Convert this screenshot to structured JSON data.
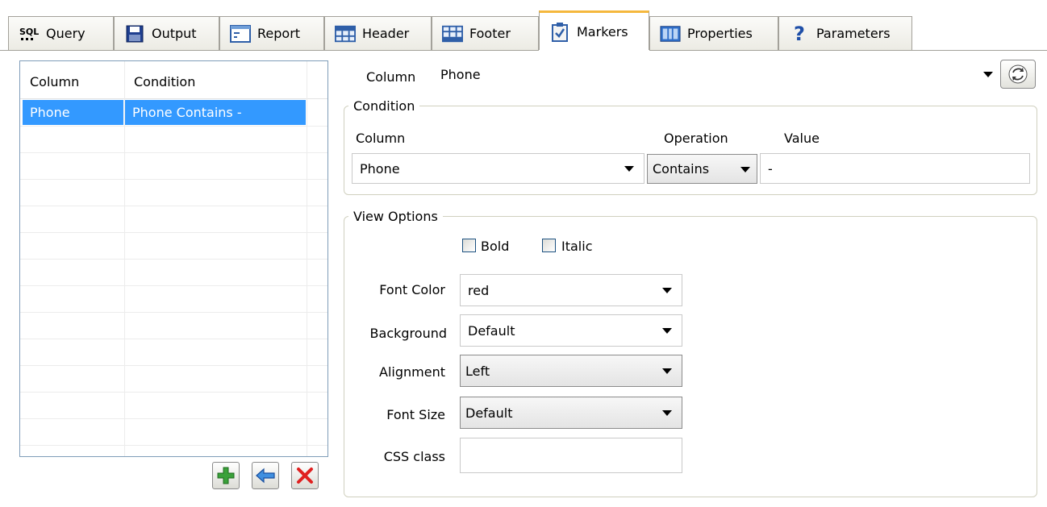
{
  "tabs": [
    {
      "label": "Query",
      "icon": "sql-icon"
    },
    {
      "label": "Output",
      "icon": "floppy-disk-icon"
    },
    {
      "label": "Report",
      "icon": "report-icon"
    },
    {
      "label": "Header",
      "icon": "table-header-icon"
    },
    {
      "label": "Footer",
      "icon": "table-footer-icon"
    },
    {
      "label": "Markers",
      "icon": "checklist-icon",
      "active": true
    },
    {
      "label": "Properties",
      "icon": "properties-icon"
    },
    {
      "label": "Parameters",
      "icon": "question-mark-icon"
    }
  ],
  "sql_icon_text": "SQL",
  "question_mark_glyph": "?",
  "markers_list": {
    "columns": [
      "Column",
      "Condition"
    ],
    "rows": [
      {
        "column": "Phone",
        "condition": "Phone Contains -",
        "selected": true
      }
    ]
  },
  "list_buttons": {
    "add": "plus-icon",
    "move": "arrow-left-icon",
    "delete": "x-delete-icon"
  },
  "column_selector": {
    "label": "Column",
    "value": "Phone"
  },
  "condition": {
    "legend": "Condition",
    "column_header": "Column",
    "operation_header": "Operation",
    "value_header": "Value",
    "column_value": "Phone",
    "operation_value": "Contains",
    "value_value": "-"
  },
  "view_options": {
    "legend": "View Options",
    "bold_label": "Bold",
    "italic_label": "Italic",
    "bold_checked": false,
    "italic_checked": false,
    "font_color_label": "Font Color",
    "font_color_value": "red",
    "background_label": "Background",
    "background_value": "Default",
    "alignment_label": "Alignment",
    "alignment_value": "Left",
    "font_size_label": "Font Size",
    "font_size_value": "Default",
    "css_class_label": "CSS class",
    "css_class_value": ""
  },
  "colors": {
    "selection": "#3399ff",
    "active_tab_accent": "#f5b83d",
    "list_border": "#7f9db9",
    "group_border": "#d0d0bf"
  }
}
